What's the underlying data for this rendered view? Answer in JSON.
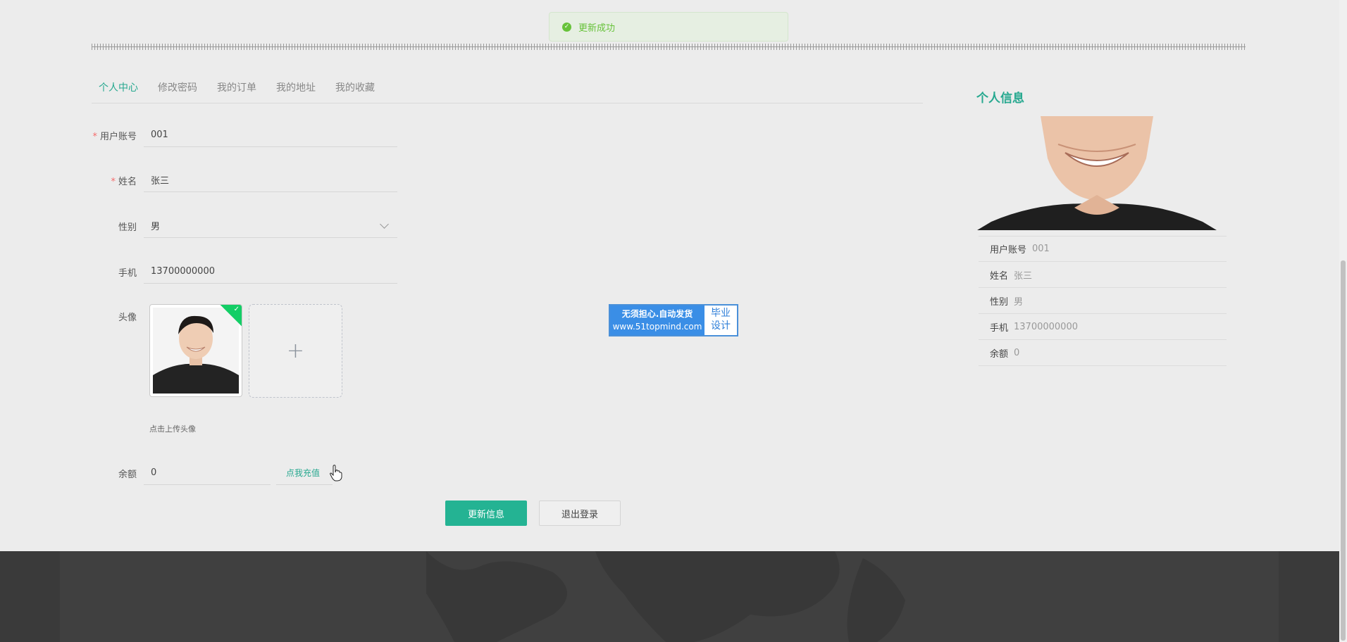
{
  "toast": {
    "message": "更新成功"
  },
  "tabs": [
    "个人中心",
    "修改密码",
    "我的订单",
    "我的地址",
    "我的收藏"
  ],
  "form": {
    "account_label": "用户账号",
    "account_value": "001",
    "name_label": "姓名",
    "name_value": "张三",
    "gender_label": "性别",
    "gender_value": "男",
    "phone_label": "手机",
    "phone_value": "13700000000",
    "avatar_label": "头像",
    "avatar_hint": "点击上传头像",
    "balance_label": "余额",
    "balance_value": "0",
    "recharge_link": "点我充值"
  },
  "buttons": {
    "update": "更新信息",
    "logout": "退出登录"
  },
  "ad": {
    "line1": "无须担心.自动发货",
    "url": "www.51topmind.com",
    "right1": "毕业",
    "right2": "设计"
  },
  "sidebar": {
    "title": "个人信息",
    "items": [
      {
        "label": "用户账号",
        "value": "001"
      },
      {
        "label": "姓名",
        "value": "张三"
      },
      {
        "label": "性别",
        "value": "男"
      },
      {
        "label": "手机",
        "value": "13700000000"
      },
      {
        "label": "余额",
        "value": "0"
      }
    ]
  },
  "colors": {
    "accent": "#26a88f",
    "primary_button": "#24b393",
    "success": "#67c23a",
    "footer": "#3a3a3a"
  }
}
